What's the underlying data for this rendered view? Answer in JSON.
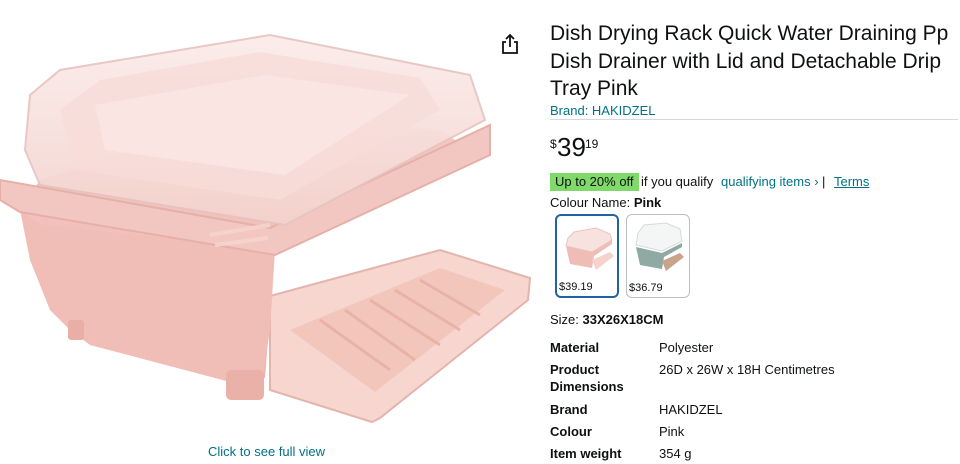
{
  "gallery": {
    "full_view_link": "Click to see full view"
  },
  "product": {
    "title": "Dish Drying Rack Quick Water Draining Pp Dish Drainer with Lid and Detachable Drip Tray Pink",
    "brand_link": "Brand: HAKIDZEL",
    "price": {
      "symbol": "$",
      "whole": "39",
      "fraction": "19"
    },
    "promo": {
      "badge": "Up to 20% off",
      "text": "if you qualify",
      "qualify_link": "qualifying items ›",
      "separator": "|",
      "terms_link": "Terms"
    },
    "colour": {
      "label": "Colour Name:",
      "value": "Pink",
      "swatches": [
        {
          "price": "$39.19",
          "selected": true,
          "color": "pink"
        },
        {
          "price": "$36.79",
          "selected": false,
          "color": "grey-green"
        }
      ]
    },
    "size": {
      "label": "Size:",
      "value": "33X26X18CM"
    },
    "specs": [
      {
        "label": "Material",
        "value": "Polyester"
      },
      {
        "label": "Product Dimensions",
        "value": "26D x 26W x 18H Centimetres"
      },
      {
        "label": "Brand",
        "value": "HAKIDZEL"
      },
      {
        "label": "Colour",
        "value": "Pink"
      },
      {
        "label": "Item weight",
        "value": "354 g"
      }
    ]
  },
  "colors": {
    "link": "#007185",
    "promo_badge": "#7FDA69",
    "selected_swatch_border": "#2162A1",
    "product_pink": "#F2C4C0"
  },
  "icons": {
    "share": "share-icon"
  }
}
